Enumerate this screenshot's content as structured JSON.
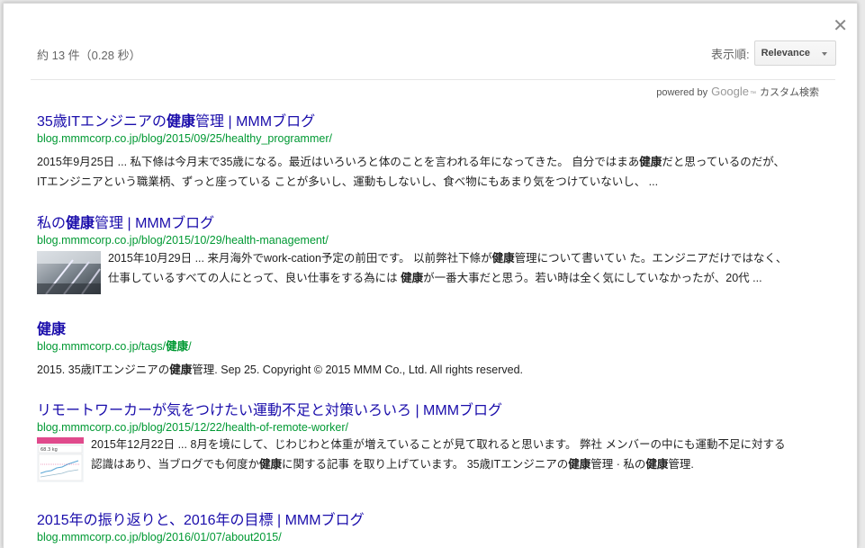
{
  "header": {
    "result_count": "約 13 件（0.28 秒）",
    "sort_label": "表示順:",
    "sort_value": "Relevance",
    "branding": {
      "powered": "powered by",
      "logo": "Google",
      "tm": "™",
      "suffix": "カスタム検索"
    },
    "close_icon": "close-icon"
  },
  "results": [
    {
      "title_pre": "35歳ITエンジニアの",
      "title_bold": "健康",
      "title_post": "管理 | MMMブログ",
      "url": "blog.mmmcorp.co.jp/blog/2015/09/25/healthy_programmer/",
      "snippet_l1_pre": "2015年9月25日 ... 私下條は今月末で35歳になる。最近はいろいろと体のことを言われる年になってきた。 自分ではまあ",
      "snippet_l1_bold": "健康",
      "snippet_l1_post": "だと思っているのだが、",
      "snippet_l2": "ITエンジニアという職業柄、ずっと座っている ことが多いし、運動もしないし、食べ物にもあまり気をつけていないし、 ..."
    },
    {
      "title_pre": "私の",
      "title_bold": "健康",
      "title_post": "管理 | MMMブログ",
      "url": "blog.mmmcorp.co.jp/blog/2015/10/29/health-management/",
      "snippet_l1_pre": "2015年10月29日 ... 来月海外でwork-cation予定の前田です。 以前弊社下條が",
      "snippet_l1_bold": "健康",
      "snippet_l1_post": "管理について書いてい た。エンジニアだけではなく、",
      "snippet_l2_pre": "仕事しているすべての人にとって、良い仕事をする為には ",
      "snippet_l2_bold": "健康",
      "snippet_l2_post": "が一番大事だと思う。若い時は全く気にしていなかったが、20代 ..."
    },
    {
      "title_bold": "健康",
      "url_pre": "blog.mmmcorp.co.jp/tags/",
      "url_bold": "健康",
      "url_post": "/",
      "snippet_pre": "2015. 35歳ITエンジニアの",
      "snippet_bold": "健康",
      "snippet_post": "管理. Sep 25. Copyright © 2015 MMM Co., Ltd. All rights reserved."
    },
    {
      "title": "リモートワーカーが気をつけたい運動不足と対策いろいろ | MMMブログ",
      "url": "blog.mmmcorp.co.jp/blog/2015/12/22/health-of-remote-worker/",
      "snippet_l1": "2015年12月22日 ... 8月を境にして、じわじわと体重が増えていることが見て取れると思います。 弊社 メンバーの中にも運動不足に対する",
      "snippet_l2_pre": "認識はあり、当ブログでも何度か",
      "snippet_l2_bold1": "健康",
      "snippet_l2_mid1": "に関する記事 を取り上げています。 35歳ITエンジニアの",
      "snippet_l2_bold2": "健康",
      "snippet_l2_mid2": "管理 · 私の",
      "snippet_l2_bold3": "健康",
      "snippet_l2_post": "管理.",
      "thumb_text": "68.3 kg"
    },
    {
      "title": "2015年の振り返りと、2016年の目標 | MMMブログ",
      "url": "blog.mmmcorp.co.jp/blog/2016/01/07/about2015/"
    }
  ]
}
